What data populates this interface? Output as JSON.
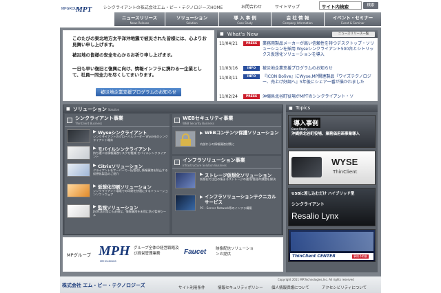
{
  "header": {
    "group_label": "MPGROUP",
    "logo": "MPT",
    "tagline": "シンクライアントの株式会社エム・ピー・テクノロジーズHOME",
    "top_nav": [
      "お問合わせ",
      "サイトマップ"
    ],
    "site_search_label": "サイト内検索",
    "search_button": "検索",
    "main_tabs": [
      {
        "label": "ニュースリリース",
        "en": "News Release"
      },
      {
        "label": "ソリューション",
        "en": "Solution"
      },
      {
        "label": "導 入 事 例",
        "en": "Case Study"
      },
      {
        "label": "会 社 情 報",
        "en": "Company Information"
      },
      {
        "label": "イベント・セミナー",
        "en": "Event & Seminar"
      }
    ]
  },
  "announcement": {
    "paragraph1": "このたびの東北地方太平洋沖地震で被災された皆様には、心よりお見舞い申し上げます。",
    "paragraph2": "被災地の皆様の安全を心からお祈り申し上げます。",
    "paragraph3": "一日も早い復旧と復興に向け、情報インフラに携わる一企業として、社員一同全力を尽くしてまいります。",
    "button": "被災地企業支援プログラムのお知らせ"
  },
  "news": {
    "title": "What's New",
    "list_button": "ニュースリリース一覧",
    "items": [
      {
        "date": "11/04/21",
        "badge": "PRESS",
        "text": "業務用製品メーカーが高い信頼性を持つデスクトップ・ソリューションを採用 Wyseシンクライアント500台とシトリックス仮想化ソリューションを導入"
      },
      {
        "date": "11/03/16",
        "badge": "INFO",
        "text": "被災地企業支援プログラムのお知らせ"
      },
      {
        "date": "11/03/11",
        "badge": "INFO",
        "text": "『ICON Bolive』にWyse,MP関連製品『ワイズテクノロジー、売上げ好調へ』5年後にシェア一番が描かれました"
      },
      {
        "date": "11/02/24",
        "badge": "PRESS",
        "text": "沖縄県北谷町役場がMPTのシンクライアント・ソ"
      }
    ],
    "colors": {
      "press": "#cc1f2d",
      "info": "#2a4f9e"
    }
  },
  "solutions": {
    "title": "ソリューション",
    "title_en": "Solution",
    "left": {
      "category": "シンクライアント事業",
      "category_en": "ThinClient Business",
      "items": [
        {
          "title": "Wyseシンクライアント",
          "desc": "シンクライアントのグローバルリーダー Wyse社のシンクライアント端末"
        },
        {
          "title": "モバイルシンクライアント",
          "desc": "持ち運べる情報漏洩リスクを軽減 モバイルシンクライアント"
        },
        {
          "title": "Citrixソリューション",
          "desc": "クライアントをサーバーで一括管理し情報漏洩を防止する仮想化製品のご紹介"
        },
        {
          "title": "仮想化印刷ソリューション",
          "desc": "シンクライアント環境での印刷を快適にするソリューションソフトウェア"
        },
        {
          "title": "監視ソリューション",
          "desc": "JSOX法対策にも必須な、情報漏洩を未然に防ぐ監視ツール"
        }
      ]
    },
    "right_top": {
      "category": "WEBセキュリティ事業",
      "category_en": "WEB Security Business",
      "items": [
        {
          "title": "WEBコンテンツ保護ソリューション",
          "desc": "内部からの情報漏洩対策に"
        }
      ]
    },
    "right_bottom": {
      "category": "インフラソリューション事業",
      "category_en": "Infrastructure Solution Business",
      "items": [
        {
          "title": "ストレージ仮想化ソリューション",
          "desc": "仮想化で注目の集まるストレージの運用/管理の課題を解決"
        },
        {
          "title": "インフラソリューションテクニカルサービス",
          "desc": "PC・Server Network等のインフラ構築"
        }
      ]
    }
  },
  "topics": {
    "title": "Topics",
    "banners": [
      {
        "line1": "導入事例",
        "line2": "沖縄県北谷町役場、業務価用画事業導入",
        "tag": "Case Study"
      },
      {
        "line1": "WYSE",
        "line2": "ThinClient"
      },
      {
        "line1": "USBに差し込むだけ ハイブリッド型",
        "line2": "シンクライアント",
        "line3": "Resalio Lynx"
      },
      {
        "line1": "ThinClient CENTER",
        "line2": "事例予約制"
      }
    ]
  },
  "group": {
    "label": "MPグループ",
    "mph_logo": "MPH",
    "mph_sub": "MPHOLDINGS",
    "mph_desc": "グループ全体の経営戦略及び経営管理業務",
    "faucet_logo": "Faucet",
    "faucet_desc": "映像配信ソリューションの提供"
  },
  "footer": {
    "company": "株式会社 エム・ピー・テクノロジーズ",
    "copyright": "Copyright 2011 MP.Technologies,Inc. All rights reserved",
    "links": [
      "サイト利用条件",
      "情報セキュリティポリシー",
      "個人情報保護について",
      "アクセシビリティについて"
    ]
  }
}
